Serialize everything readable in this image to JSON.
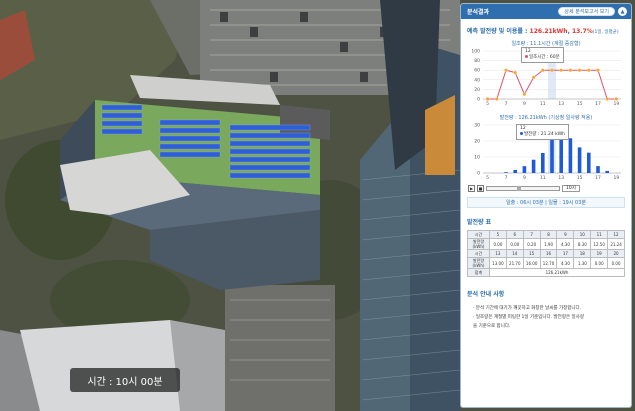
{
  "panel": {
    "title": "분석결과",
    "report_button": "상세 분석보고서 보기",
    "collapse_icon": "chevron-up-icon",
    "summary_prefix": "예측 발전량 및 이용률 : ",
    "summary_energy": "126.21kWh",
    "summary_sep": ", ",
    "summary_rate": "13.7%",
    "summary_rate_note": "(1일, 일평균)",
    "daylight_chart_title": "일조량 : 11.1시간 (계절 증감형)",
    "generation_chart_title": "발전량 : 126.21kWh (기상청 일사량 적용)",
    "tooltip_daylight_time": "12",
    "tooltip_daylight_text": "일조시간 : 60분",
    "tooltip_generation_time": "12",
    "tooltip_generation_text": "발전량 : 21.24 kWh",
    "play_icon": "play-icon",
    "stop_icon": "stop-icon",
    "time_select_value": "10시",
    "sun_info": "일출 : 06시 03분  |  일몰 : 19시 03분",
    "table_title": "발전량 표",
    "table": {
      "head_label": "시간",
      "unit_label": "발전량(kWh)",
      "row1_hours": [
        "5",
        "6",
        "7",
        "8",
        "9",
        "10",
        "11",
        "12"
      ],
      "row1_values": [
        "0.00",
        "0.00",
        "0.20",
        "1.90",
        "4.30",
        "8.30",
        "12.50",
        "21.24"
      ],
      "row2_hours": [
        "13",
        "14",
        "15",
        "16",
        "17",
        "18",
        "19",
        "20"
      ],
      "row2_values": [
        "13.00",
        "21.70",
        "16.00",
        "12.70",
        "4.30",
        "1.30",
        "0.00",
        "0.00"
      ],
      "total_label": "합계",
      "total_value": "126.21kWh"
    },
    "info_title": "분석 안내 사항",
    "info_lines": [
      "· 분석 기간에 대기가 깨끗하고 화창한 날씨를 가정합니다.",
      "· 일조량은 계절별 피팅한 1일 기준입니다. 발전량은 일사량",
      "  을 기준으로 합니다."
    ]
  },
  "scene": {
    "time_label": "시간 : 10시 00분"
  },
  "colors": {
    "accent": "#2f6fb0",
    "highlight": "#e0322f",
    "line_series": "#e0506e",
    "point_fill": "#f5a623",
    "bar_fill": "#1f5bd8"
  },
  "chart_data": [
    {
      "type": "line",
      "title": "일조량 : 11.1시간 (계절 증감형)",
      "x": [
        5,
        6,
        7,
        8,
        9,
        10,
        11,
        12,
        13,
        14,
        15,
        16,
        17,
        18,
        19
      ],
      "values": [
        0,
        0,
        60,
        55,
        10,
        45,
        60,
        60,
        60,
        60,
        60,
        60,
        60,
        0,
        0
      ],
      "xticks": [
        5,
        7,
        9,
        11,
        13,
        15,
        17,
        19
      ],
      "ylim": [
        0,
        100
      ],
      "yticks": [
        0,
        20,
        40,
        60,
        80,
        100
      ],
      "highlight_x": 12,
      "grid": true
    },
    {
      "type": "bar",
      "title": "발전량 : 126.21kWh (기상청 일사량 적용)",
      "x": [
        7,
        8,
        9,
        10,
        11,
        12,
        13,
        14,
        15,
        16,
        17,
        18
      ],
      "values": [
        0.5,
        1.9,
        4.3,
        8.3,
        12.5,
        21.24,
        22.5,
        21.7,
        16.0,
        12.7,
        4.3,
        1.3
      ],
      "xticks": [
        5,
        7,
        9,
        11,
        13,
        15,
        17,
        19
      ],
      "ylim": [
        0,
        30
      ],
      "yticks": [
        0,
        10,
        20,
        30
      ],
      "highlight_x": 12,
      "grid": true
    }
  ]
}
